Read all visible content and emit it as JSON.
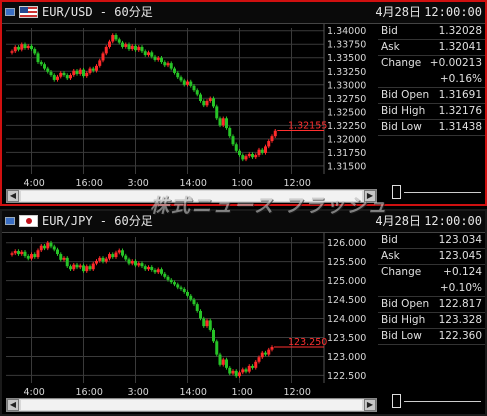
{
  "watermark": "株式ニュース フラッシュ",
  "panels": [
    {
      "id": "eurusd",
      "title": {
        "pair": "EUR/USD - 60分足",
        "date": "4月28日",
        "time": "12:00:00"
      },
      "quotes": {
        "bid_label": "Bid",
        "bid": "1.32028",
        "ask_label": "Ask",
        "ask": "1.32041",
        "change_label": "Change",
        "change": "+0.00213",
        "change_pct": "+0.16%",
        "open_label": "Bid Open",
        "open": "1.31691",
        "high_label": "Bid High",
        "high": "1.32176",
        "low_label": "Bid Low",
        "low": "1.31438"
      },
      "chart_data": {
        "type": "candlestick",
        "ylim": [
          1.3135,
          1.3405
        ],
        "yticks": [
          "1.34000",
          "1.33750",
          "1.33500",
          "1.33250",
          "1.33000",
          "1.32750",
          "1.32500",
          "1.32250",
          "1.32000",
          "1.31750",
          "1.31500"
        ],
        "ytick_values": [
          1.34,
          1.3375,
          1.335,
          1.3325,
          1.33,
          1.3275,
          1.325,
          1.3225,
          1.32,
          1.3175,
          1.315
        ],
        "xticks": [
          "4:00",
          "16:00",
          "3:00",
          "14:00",
          "1:00",
          "12:00"
        ],
        "xtick_index": [
          6,
          22,
          38,
          54,
          70,
          86
        ],
        "last_price": "1.32155",
        "last_value": 1.32155,
        "closes": [
          1.3362,
          1.337,
          1.3365,
          1.3375,
          1.3368,
          1.3372,
          1.3366,
          1.3358,
          1.3342,
          1.3338,
          1.333,
          1.3324,
          1.3318,
          1.3309,
          1.3315,
          1.3322,
          1.3318,
          1.3312,
          1.3318,
          1.3326,
          1.332,
          1.3328,
          1.3316,
          1.3322,
          1.333,
          1.3326,
          1.3335,
          1.3345,
          1.3358,
          1.337,
          1.338,
          1.3392,
          1.3384,
          1.3378,
          1.337,
          1.3375,
          1.3366,
          1.3372,
          1.3364,
          1.337,
          1.3362,
          1.3355,
          1.336,
          1.3352,
          1.3346,
          1.335,
          1.3342,
          1.3336,
          1.334,
          1.333,
          1.3322,
          1.3314,
          1.3308,
          1.33,
          1.3306,
          1.3298,
          1.329,
          1.3282,
          1.327,
          1.3262,
          1.327,
          1.3275,
          1.326,
          1.3238,
          1.3225,
          1.3238,
          1.322,
          1.3205,
          1.319,
          1.3178,
          1.317,
          1.3162,
          1.3168,
          1.3172,
          1.3166,
          1.317,
          1.318,
          1.3174,
          1.3186,
          1.3196,
          1.3205,
          1.3215
        ]
      }
    },
    {
      "id": "eurjpy",
      "title": {
        "pair": "EUR/JPY - 60分足",
        "date": "4月28日",
        "time": "12:00:00"
      },
      "quotes": {
        "bid_label": "Bid",
        "bid": "123.034",
        "ask_label": "Ask",
        "ask": "123.045",
        "change_label": "Change",
        "change": "+0.124",
        "change_pct": "+0.10%",
        "open_label": "Bid Open",
        "open": "122.817",
        "high_label": "Bid High",
        "high": "123.328",
        "low_label": "Bid Low",
        "low": "122.360"
      },
      "chart_data": {
        "type": "candlestick",
        "ylim": [
          122.3,
          126.15
        ],
        "yticks": [
          "126.000",
          "125.500",
          "125.000",
          "124.500",
          "124.000",
          "123.500",
          "123.000",
          "122.500"
        ],
        "ytick_values": [
          126,
          125.5,
          125,
          124.5,
          124,
          123.5,
          123,
          122.5
        ],
        "xticks": [
          "4:00",
          "16:00",
          "3:00",
          "14:00",
          "1:00",
          "12:00"
        ],
        "xtick_index": [
          6,
          22,
          38,
          54,
          70,
          86
        ],
        "last_price": "123.250",
        "last_value": 123.25,
        "closes": [
          125.72,
          125.78,
          125.7,
          125.76,
          125.65,
          125.58,
          125.7,
          125.62,
          125.8,
          125.92,
          125.85,
          126.0,
          125.9,
          125.82,
          125.7,
          125.55,
          125.6,
          125.38,
          125.3,
          125.42,
          125.35,
          125.4,
          125.25,
          125.38,
          125.3,
          125.45,
          125.52,
          125.6,
          125.5,
          125.58,
          125.7,
          125.62,
          125.74,
          125.8,
          125.66,
          125.56,
          125.45,
          125.52,
          125.4,
          125.46,
          125.38,
          125.3,
          125.36,
          125.28,
          125.22,
          125.3,
          125.18,
          125.1,
          125.02,
          124.96,
          124.9,
          124.82,
          124.78,
          124.7,
          124.6,
          124.5,
          124.38,
          124.2,
          124.0,
          123.8,
          123.95,
          123.7,
          123.4,
          123.05,
          122.78,
          122.92,
          122.7,
          122.55,
          122.62,
          122.48,
          122.58,
          122.66,
          122.6,
          122.75,
          122.7,
          122.86,
          122.98,
          123.1,
          123.05,
          123.18,
          123.25
        ]
      }
    }
  ]
}
